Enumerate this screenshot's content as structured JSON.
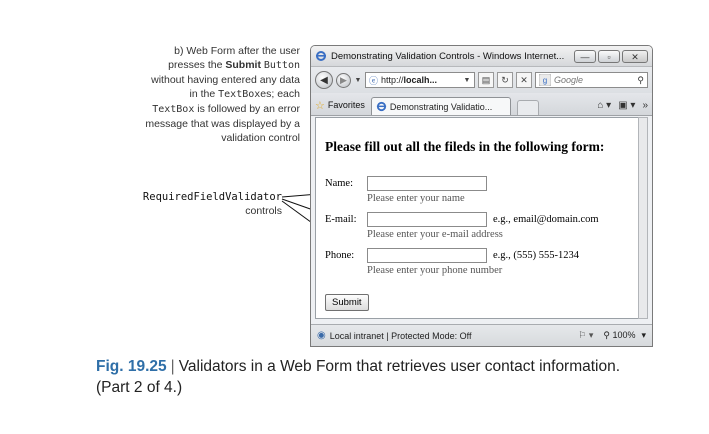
{
  "annotation": {
    "line1": "b) Web Form after the user",
    "line2_pre": "presses the ",
    "line2_bold": "Submit",
    "line2_mono": "Button",
    "line3": "without having entered any data",
    "line4_pre": "in the ",
    "line4_mono": "TextBox",
    "line4_post": "es; each",
    "line5_mono": "TextBox",
    "line5_post": " is followed by an error",
    "line6": "message that was displayed by a",
    "line7": "validation control",
    "rfv_label": "RequiredFieldValidator",
    "rfv_sub": "controls"
  },
  "browser": {
    "window_title": "Demonstrating Validation Controls - Windows Internet...",
    "win_min": "—",
    "win_max": "▫",
    "win_close": "✕",
    "address_pre": "http://",
    "address_bold": "localh...",
    "search_placeholder": "Google",
    "favorites_label": "Favorites",
    "tab_label": "Demonstrating Validatio...",
    "status_zone": "Local intranet | Protected Mode: Off",
    "zoom": "100%"
  },
  "form": {
    "heading": "Please fill out all the fileds in the following form:",
    "name_label": "Name:",
    "name_value": "",
    "name_error": "Please enter your name",
    "email_label": "E-mail:",
    "email_value": "",
    "email_hint": "e.g., email@domain.com",
    "email_error": "Please enter your e-mail address",
    "phone_label": "Phone:",
    "phone_value": "",
    "phone_hint": "e.g., (555) 555-1234",
    "phone_error": "Please enter your phone number",
    "submit_label": "Submit"
  },
  "caption": {
    "fig_number": "Fig. 19.25",
    "separator": "|",
    "text": "Validators in a Web Form that retrieves user contact information. (Part 2 of 4.)"
  }
}
